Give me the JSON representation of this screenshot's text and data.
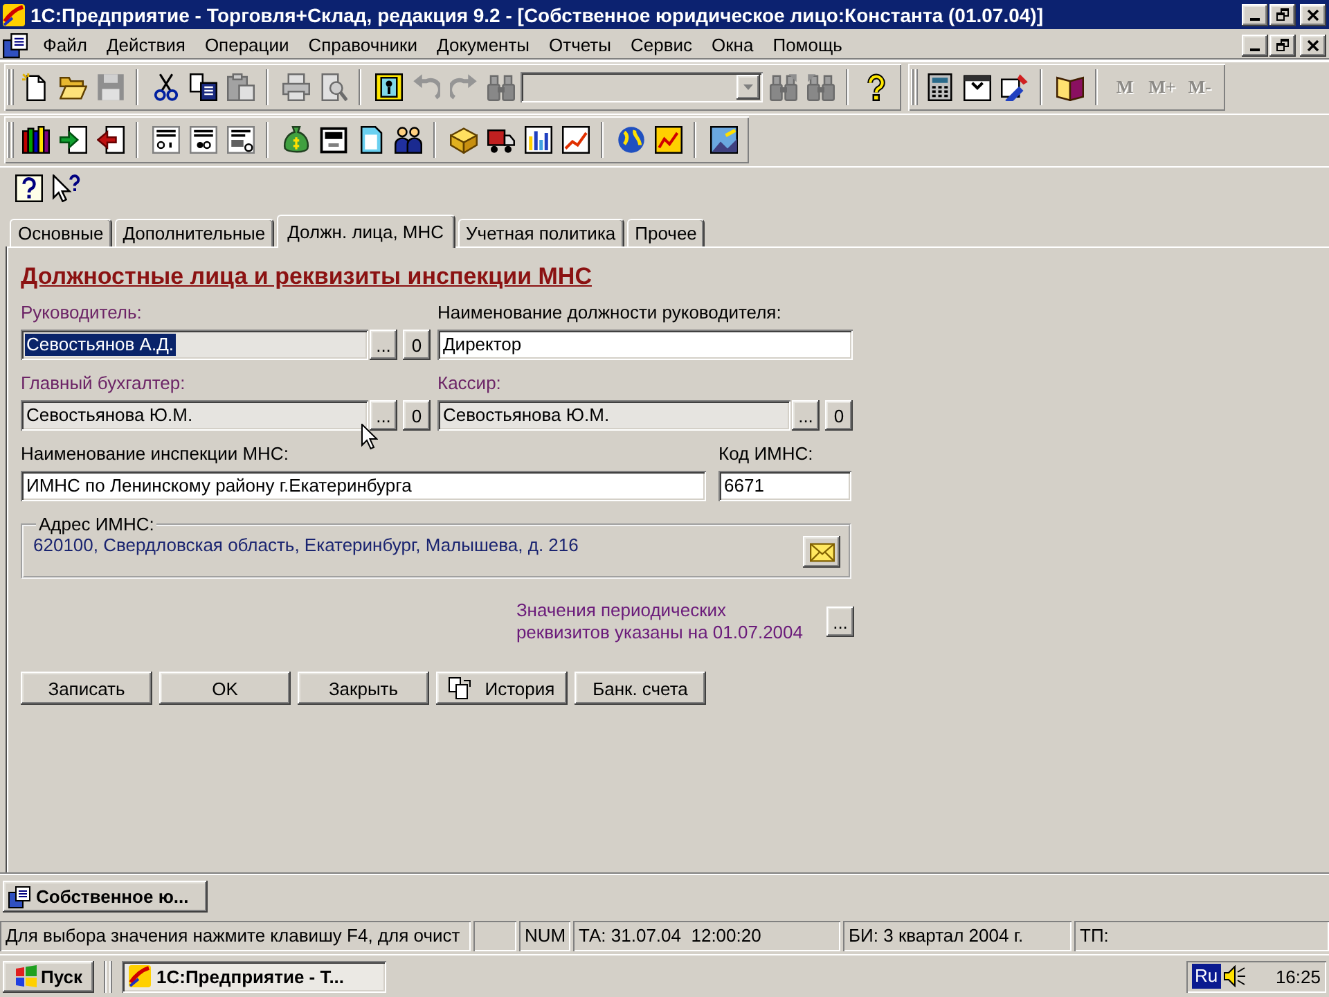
{
  "window": {
    "title": "1С:Предприятие - Торговля+Склад, редакция 9.2 - [Собственное юридическое лицо:Константа (01.07.04)]"
  },
  "menu": [
    "Файл",
    "Действия",
    "Операции",
    "Справочники",
    "Документы",
    "Отчеты",
    "Сервис",
    "Окна",
    "Помощь"
  ],
  "toolbar_rows": [
    {
      "toolbars": [
        {
          "kind": "docked",
          "groups": [
            [
              {
                "kind": "new",
                "disabled": false
              },
              {
                "kind": "open",
                "disabled": false
              },
              {
                "kind": "save",
                "disabled": true
              }
            ],
            [
              {
                "kind": "cut",
                "disabled": false
              },
              {
                "kind": "copy",
                "disabled": false
              },
              {
                "kind": "paste",
                "disabled": true
              }
            ],
            [
              {
                "kind": "print",
                "disabled": true
              },
              {
                "kind": "preview",
                "disabled": true
              }
            ],
            [
              {
                "kind": "catalog",
                "disabled": false
              },
              {
                "kind": "undo",
                "disabled": true
              },
              {
                "kind": "redo",
                "disabled": true
              },
              {
                "kind": "find",
                "disabled": true
              },
              {
                "kind": "combo",
                "disabled": true
              },
              {
                "kind": "findnext",
                "disabled": true
              },
              {
                "kind": "findprev",
                "disabled": true
              }
            ],
            [
              {
                "kind": "help",
                "disabled": false
              }
            ]
          ]
        },
        {
          "kind": "docked",
          "groups": [
            [
              {
                "kind": "calculator",
                "disabled": false
              },
              {
                "kind": "calendar",
                "disabled": false
              },
              {
                "kind": "edit",
                "disabled": false
              }
            ],
            [
              {
                "kind": "book",
                "disabled": false
              }
            ],
            [
              {
                "kind": "memory",
                "label": "M",
                "disabled": true
              },
              {
                "kind": "memory",
                "label": "M+",
                "disabled": true
              },
              {
                "kind": "memory",
                "label": "M-",
                "disabled": true
              }
            ]
          ]
        }
      ]
    },
    {
      "toolbars": [
        {
          "kind": "docked",
          "groups": [
            [
              {
                "kind": "books",
                "disabled": false
              },
              {
                "kind": "import",
                "disabled": false
              },
              {
                "kind": "export",
                "disabled": false
              }
            ],
            [
              {
                "kind": "invoice",
                "disabled": false
              },
              {
                "kind": "act",
                "disabled": false
              },
              {
                "kind": "waybill",
                "disabled": false
              }
            ],
            [
              {
                "kind": "bag",
                "disabled": false
              },
              {
                "kind": "register",
                "disabled": false
              },
              {
                "kind": "page",
                "disabled": false
              },
              {
                "kind": "people",
                "disabled": false
              }
            ],
            [
              {
                "kind": "box",
                "disabled": false
              },
              {
                "kind": "truck",
                "disabled": false
              },
              {
                "kind": "columns",
                "disabled": false
              },
              {
                "kind": "linechart",
                "disabled": false
              }
            ],
            [
              {
                "kind": "globe",
                "disabled": false
              },
              {
                "kind": "report",
                "disabled": false
              }
            ],
            [
              {
                "kind": "picture",
                "disabled": false
              }
            ]
          ]
        }
      ]
    },
    {
      "toolbars": [
        {
          "kind": "plain",
          "groups": [
            [
              {
                "kind": "helpbox",
                "disabled": false
              },
              {
                "kind": "whatsthis",
                "disabled": false
              }
            ]
          ]
        }
      ]
    }
  ],
  "tabs": [
    {
      "label": "Основные",
      "selected": false
    },
    {
      "label": "Дополнительные",
      "selected": false
    },
    {
      "label": "Должн. лица, МНС",
      "selected": true
    },
    {
      "label": "Учетная политика",
      "selected": false
    },
    {
      "label": "Прочее",
      "selected": false
    }
  ],
  "form": {
    "heading": "Должностные лица и реквизиты инспекции МНС",
    "rows": [
      [
        {
          "kind": "reference",
          "label": "Руководитель:",
          "value": "Севостьянов А.Д.",
          "selected": true,
          "select_button": "...",
          "clear_button": "0"
        },
        {
          "kind": "text",
          "label": "Наименование должности руководителя:",
          "value": "Директор",
          "selected": false
        }
      ],
      [
        {
          "kind": "reference",
          "label": "Главный бухгалтер:",
          "value": "Севостьянова Ю.М.",
          "selected": false,
          "select_button": "...",
          "clear_button": "0"
        },
        {
          "kind": "reference",
          "label": "Кассир:",
          "value": "Севостьянова Ю.М.",
          "selected": false,
          "select_button": "...",
          "clear_button": "0"
        }
      ],
      [
        {
          "kind": "text",
          "label": "Наименование инспекции МНС:",
          "value": "ИМНС по Ленинскому району г.Екатеринбурга",
          "selected": false
        },
        {
          "kind": "text",
          "label": "Код ИМНС:",
          "value": "6671",
          "selected": false
        }
      ]
    ],
    "address": {
      "label": "Адрес ИМНС:",
      "value": "620100, Свердловская область, Екатеринбург, Малышева, д. 216"
    },
    "note": {
      "text": "Значения периодических\nреквизитов указаны на 01.07.2004",
      "button": "..."
    },
    "buttons": [
      {
        "kind": "plain",
        "label": "Записать"
      },
      {
        "kind": "plain",
        "label": "OK"
      },
      {
        "kind": "plain",
        "label": "Закрыть"
      },
      {
        "kind": "history",
        "label": "История"
      },
      {
        "kind": "plain",
        "label": "Банк. счета"
      }
    ]
  },
  "window_bar": {
    "label": "Собственное ю..."
  },
  "status_bar": [
    "Для выбора значения нажмите клавишу F4, для очист",
    "NUM",
    "ТА: 31.07.04  12:00:20",
    "БИ: 3 квартал 2004 г.",
    "ТП:"
  ],
  "taskbar": {
    "start": "Пуск",
    "tasks": [
      {
        "label": "1С:Предприятие - Т...",
        "selected": true
      }
    ],
    "language": "Ru",
    "clock": "16:25"
  }
}
